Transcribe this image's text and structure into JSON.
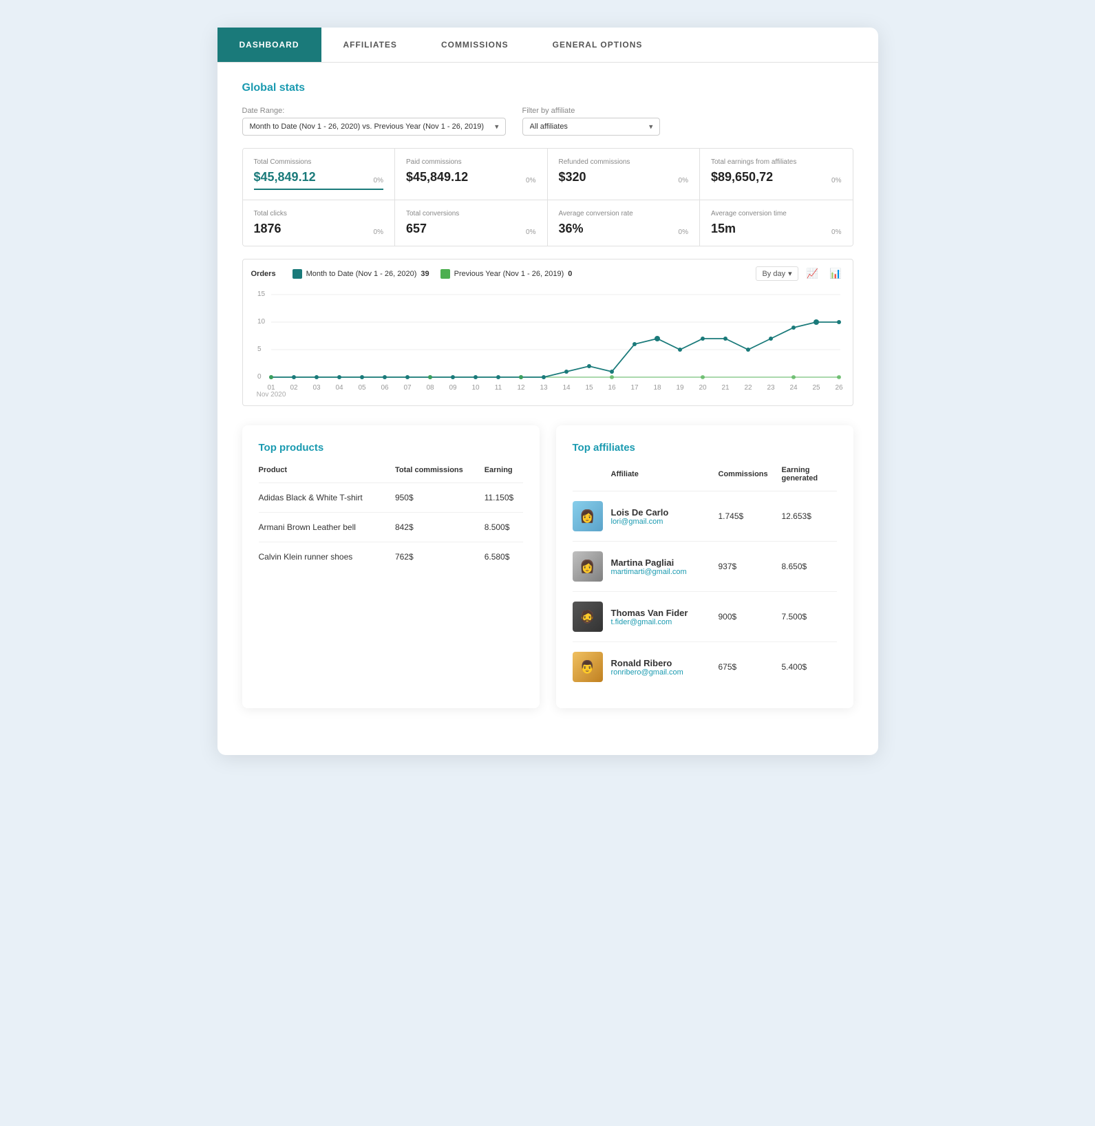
{
  "tabs": [
    {
      "label": "DASHBOARD",
      "id": "dashboard",
      "active": true
    },
    {
      "label": "AFFILIATES",
      "id": "affiliates",
      "active": false
    },
    {
      "label": "COMMISSIONS",
      "id": "commissions",
      "active": false
    },
    {
      "label": "GENERAL OPTIONS",
      "id": "general-options",
      "active": false
    }
  ],
  "global_stats": {
    "title": "Global stats",
    "date_range_label": "Date Range:",
    "date_range_value": "Month to Date (Nov 1 - 26, 2020)\nvs. Previous Year (Nov 1 - 26, 2019)",
    "filter_affiliate_label": "Filter by affiliate",
    "filter_affiliate_value": "All affiliates",
    "stats": [
      {
        "label": "Total Commissions",
        "value": "$45,849.12",
        "change": "0%",
        "highlighted": true
      },
      {
        "label": "Paid commissions",
        "value": "$45,849.12",
        "change": "0%"
      },
      {
        "label": "Refunded commissions",
        "value": "$320",
        "change": "0%"
      },
      {
        "label": "Total earnings from affiliates",
        "value": "$89,650,72",
        "change": "0%"
      },
      {
        "label": "Total clicks",
        "value": "1876",
        "change": "0%"
      },
      {
        "label": "Total conversions",
        "value": "657",
        "change": "0%"
      },
      {
        "label": "Average conversion rate",
        "value": "36%",
        "change": "0%"
      },
      {
        "label": "Average conversion time",
        "value": "15m",
        "change": "0%"
      }
    ],
    "chart": {
      "orders_label": "Orders",
      "legend": [
        {
          "label": "Month to Date (Nov 1 - 26, 2020)",
          "count": "39",
          "color": "blue"
        },
        {
          "label": "Previous Year (Nov 1 - 26, 2019)",
          "count": "0",
          "color": "green"
        }
      ],
      "by_day": "By day",
      "x_labels": [
        "01",
        "02",
        "03",
        "04",
        "05",
        "06",
        "07",
        "08",
        "09",
        "10",
        "11",
        "12",
        "13",
        "14",
        "15",
        "16",
        "17",
        "18",
        "19",
        "20",
        "21",
        "22",
        "23",
        "24",
        "25",
        "26"
      ],
      "y_labels": [
        "15",
        "10",
        "5",
        "0"
      ],
      "data_points": [
        0,
        0,
        0,
        0,
        0,
        0,
        0,
        0,
        0,
        0,
        0,
        0,
        0,
        1,
        2,
        1,
        6,
        7,
        5,
        7,
        7,
        5,
        7,
        9,
        10,
        10
      ]
    }
  },
  "top_products": {
    "title": "Top products",
    "columns": [
      "Product",
      "Total commissions",
      "Earning"
    ],
    "rows": [
      {
        "product": "Adidas Black & White T-shirt",
        "commissions": "950$",
        "earning": "11.150$"
      },
      {
        "product": "Armani Brown Leather bell",
        "commissions": "842$",
        "earning": "8.500$"
      },
      {
        "product": "Calvin Klein runner shoes",
        "commissions": "762$",
        "earning": "6.580$"
      }
    ]
  },
  "top_affiliates": {
    "title": "Top affiliates",
    "columns": [
      "Affiliate",
      "Commissions",
      "Earning generated"
    ],
    "rows": [
      {
        "name": "Lois De Carlo",
        "email": "lori@gmail.com",
        "commissions": "1.745$",
        "earning": "12.653$",
        "avatar_color": "lois"
      },
      {
        "name": "Martina Pagliai",
        "email": "martimarti@gmail.com",
        "commissions": "937$",
        "earning": "8.650$",
        "avatar_color": "martina"
      },
      {
        "name": "Thomas Van Fider",
        "email": "t.fider@gmail.com",
        "commissions": "900$",
        "earning": "7.500$",
        "avatar_color": "thomas"
      },
      {
        "name": "Ronald Ribero",
        "email": "ronribero@gmail.com",
        "commissions": "675$",
        "earning": "5.400$",
        "avatar_color": "ronald"
      }
    ]
  }
}
